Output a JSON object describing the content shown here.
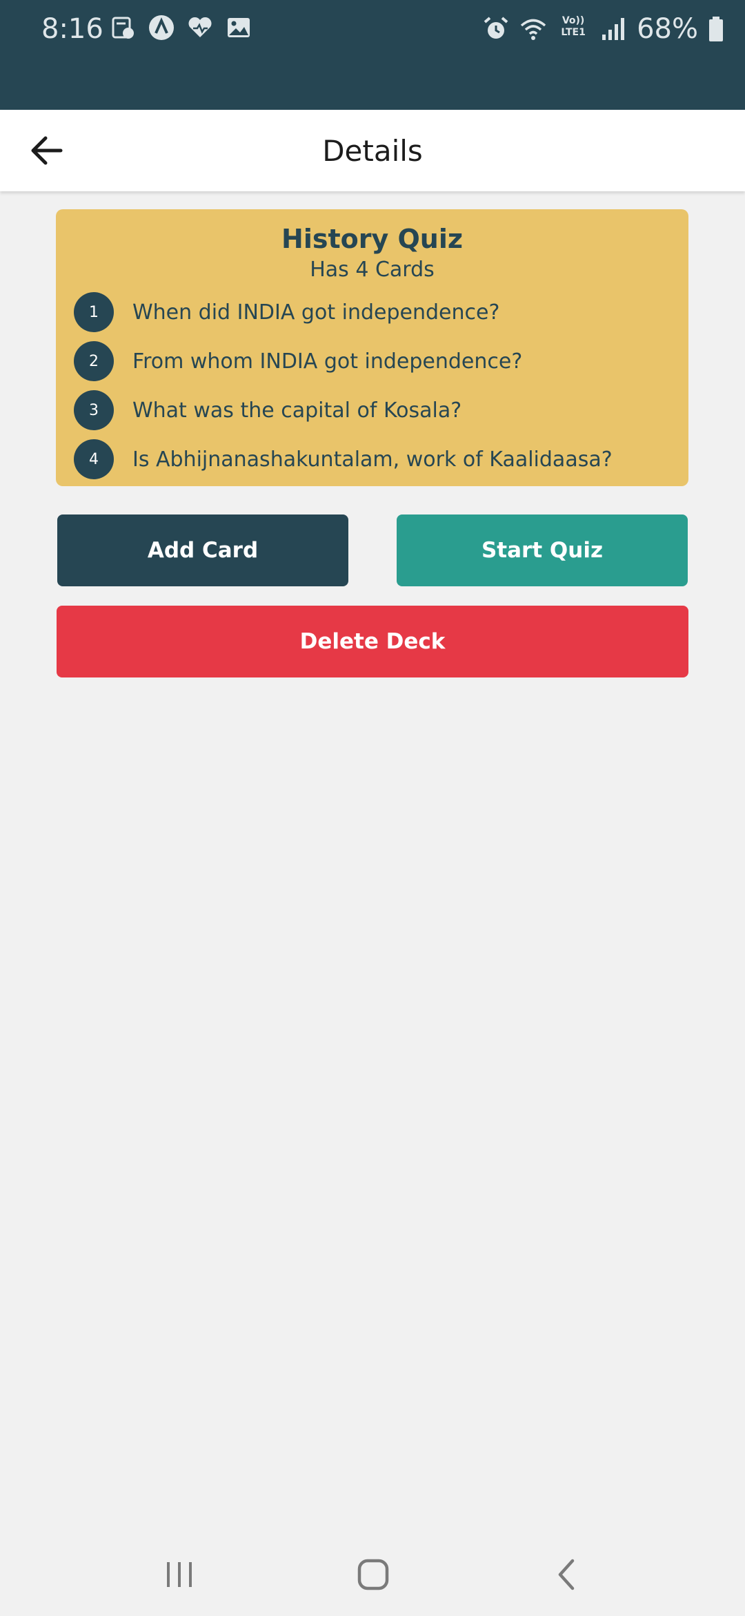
{
  "status_bar": {
    "time": "8:16",
    "battery": "68%",
    "network_label": "Vo)) LTE1",
    "left_icons": [
      "notes-icon",
      "navigation-app-icon",
      "health-icon",
      "gallery-icon"
    ],
    "right_icons": [
      "alarm-icon",
      "wifi-icon",
      "lte-signal-icon",
      "cell-signal-icon",
      "battery-icon"
    ],
    "background": "#264653"
  },
  "header": {
    "title": "Details",
    "back_icon": "arrow-left-icon"
  },
  "deck": {
    "title": "History Quiz",
    "subtitle": "Has 4 Cards",
    "background": "#e9c46a",
    "text_color": "#264653",
    "cards": [
      {
        "number": "1",
        "question": "When did INDIA got independence?"
      },
      {
        "number": "2",
        "question": "From whom INDIA got independence?"
      },
      {
        "number": "3",
        "question": "What was the capital of Kosala?"
      },
      {
        "number": "4",
        "question": "Is Abhijnanashakuntalam, work of Kaalidaasa?"
      }
    ]
  },
  "actions": {
    "add_card": {
      "label": "Add Card",
      "color": "#264653"
    },
    "start_quiz": {
      "label": "Start Quiz",
      "color": "#2a9d8f"
    },
    "delete_deck": {
      "label": "Delete Deck",
      "color": "#e63946"
    }
  },
  "nav_bar": {
    "icons": [
      "recent-apps-icon",
      "home-icon",
      "back-icon"
    ]
  }
}
